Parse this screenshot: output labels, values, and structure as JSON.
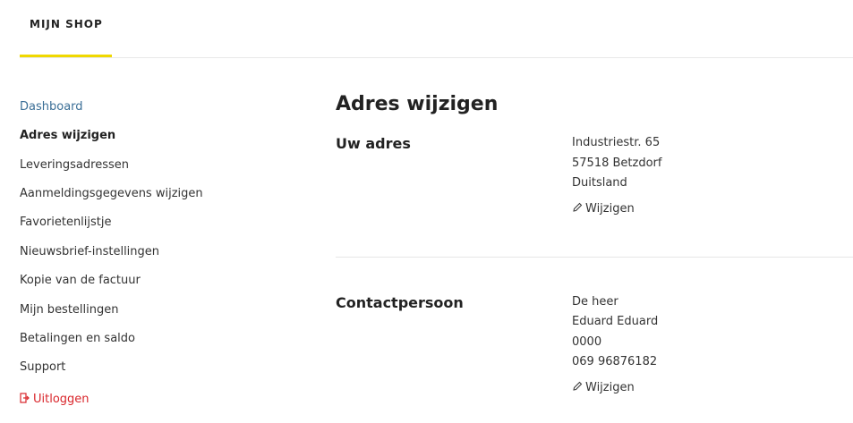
{
  "header": {
    "tab_label": "MIJN SHOP",
    "accent_color": "#f0d800"
  },
  "sidebar": {
    "items": [
      {
        "label": "Dashboard"
      },
      {
        "label": "Adres wijzigen"
      },
      {
        "label": "Leveringsadressen"
      },
      {
        "label": "Aanmeldingsgegevens wijzigen"
      },
      {
        "label": "Favorietenlijstje"
      },
      {
        "label": "Nieuwsbrief-instellingen"
      },
      {
        "label": "Kopie van de factuur"
      },
      {
        "label": "Mijn bestellingen"
      },
      {
        "label": "Betalingen en saldo"
      },
      {
        "label": "Support"
      }
    ],
    "logout": {
      "label": "Uitloggen",
      "icon": "logout-icon",
      "color": "#d9262b"
    }
  },
  "main": {
    "title": "Adres wijzigen",
    "address": {
      "title": "Uw adres",
      "lines": [
        "Industriestr. 65",
        "57518 Betzdorf",
        "Duitsland"
      ],
      "edit_label": "Wijzigen"
    },
    "contact": {
      "title": "Contactpersoon",
      "lines": [
        "De heer",
        "Eduard Eduard",
        "0000",
        "069 96876182"
      ],
      "edit_label": "Wijzigen"
    }
  }
}
